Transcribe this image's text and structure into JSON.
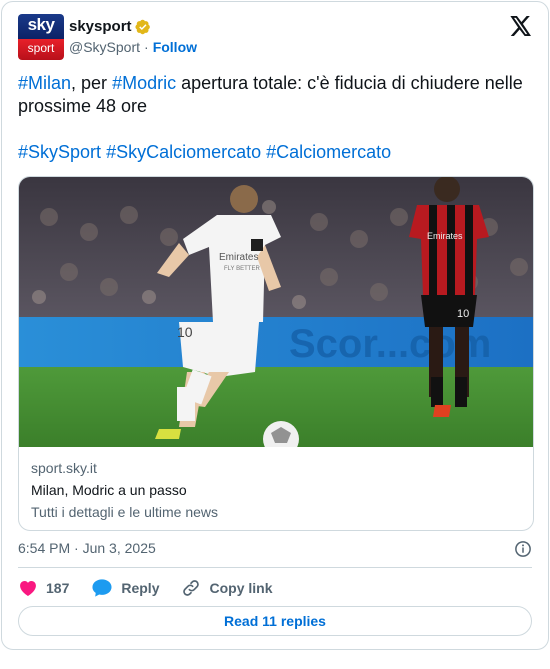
{
  "account": {
    "display_name": "skysport",
    "handle": "@SkySport",
    "separator": "·",
    "follow_label": "Follow",
    "avatar_top_text": "sky",
    "avatar_bottom_text": "sport"
  },
  "tweet": {
    "line1": [
      {
        "text": "#Milan",
        "tag": true
      },
      {
        "text": ", per ",
        "tag": false
      },
      {
        "text": "#Modric",
        "tag": true
      },
      {
        "text": " apertura totale: c'è fiducia di chiudere nelle prossime 48 ore",
        "tag": false
      }
    ],
    "hashtags": [
      "#SkySport",
      "#SkyCalciomercato",
      "#Calciomercato"
    ]
  },
  "link_card": {
    "domain": "sport.sky.it",
    "title": "Milan, Modric a un passo",
    "description": "Tutti i dettagli e le ultime news",
    "image_alt": "Modric in Real Madrid white kit dribbling, Milan player in red and black in background",
    "photo_texts": {
      "shirt_sponsor_1": "Emirates",
      "shirt_sponsor_2": "FLY BETTER",
      "shirt_number_1": "10",
      "board_text": "Scor...com",
      "shirt_sponsor_3": "Emirates",
      "shirt_number_2": "10"
    }
  },
  "meta": {
    "time": "6:54 PM",
    "dot": "·",
    "date": "Jun 3, 2025"
  },
  "actions": {
    "likes": "187",
    "reply_label": "Reply",
    "copy_label": "Copy link"
  },
  "footer": {
    "read_replies": "Read 11 replies"
  },
  "colors": {
    "link_blue": "#006fd6",
    "like_pink": "#f91880",
    "reply_blue": "#1d9bf0",
    "muted": "#536471",
    "border": "#cfd9de"
  }
}
